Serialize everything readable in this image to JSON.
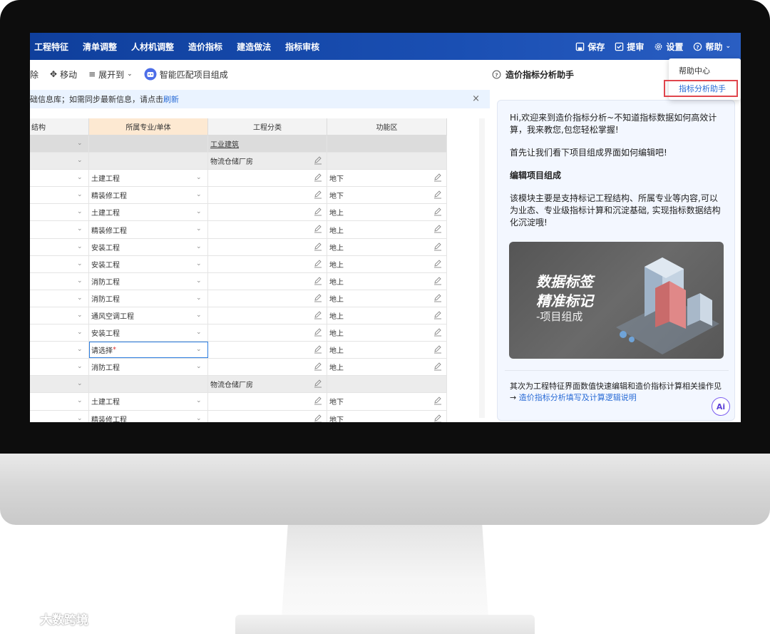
{
  "menu": [
    "工程特征",
    "清单调整",
    "人材机调整",
    "造价指标",
    "建造做法",
    "指标审核"
  ],
  "top_tools": [
    {
      "label": "保存",
      "icon": "save-icon"
    },
    {
      "label": "提审",
      "icon": "submit-icon"
    },
    {
      "label": "设置",
      "icon": "gear-icon"
    },
    {
      "label": "帮助",
      "icon": "help-icon"
    }
  ],
  "toolbar": {
    "delete": "除",
    "move": "移动",
    "expand": "展开到",
    "smart_match": "智能匹配项目组成"
  },
  "notice": {
    "prefix": "础信息库；如需同步最新信息，请点击",
    "link": "刷新",
    "close": "×"
  },
  "table": {
    "headers": [
      "结构",
      "所属专业/单体",
      "工程分类",
      "功能区"
    ],
    "rows": [
      {
        "type": "grp1",
        "c1": "",
        "c2": "",
        "c3": "工业建筑",
        "c4": ""
      },
      {
        "type": "grp",
        "c1": "",
        "c2": "",
        "c3": "物流仓储厂房",
        "c4": ""
      },
      {
        "type": "row",
        "c1": "",
        "c2": "土建工程",
        "c3": "",
        "c4": "地下"
      },
      {
        "type": "row",
        "c1": "",
        "c2": "精装修工程",
        "c3": "",
        "c4": "地下"
      },
      {
        "type": "row",
        "c1": "",
        "c2": "土建工程",
        "c3": "",
        "c4": "地上"
      },
      {
        "type": "row",
        "c1": "",
        "c2": "精装修工程",
        "c3": "",
        "c4": "地上"
      },
      {
        "type": "row",
        "c1": "",
        "c2": "安装工程",
        "c3": "",
        "c4": "地上"
      },
      {
        "type": "row",
        "c1": "",
        "c2": "安装工程",
        "c3": "",
        "c4": "地上"
      },
      {
        "type": "row",
        "c1": "",
        "c2": "消防工程",
        "c3": "",
        "c4": "地上"
      },
      {
        "type": "row",
        "c1": "",
        "c2": "消防工程",
        "c3": "",
        "c4": "地上"
      },
      {
        "type": "row",
        "c1": "",
        "c2": "通风空调工程",
        "c3": "",
        "c4": "地上"
      },
      {
        "type": "row",
        "c1": "",
        "c2": "安装工程",
        "c3": "",
        "c4": "地上"
      },
      {
        "type": "sel",
        "c1": "",
        "c2": "请选择",
        "c3": "",
        "c4": "地上"
      },
      {
        "type": "row",
        "c1": "",
        "c2": "消防工程",
        "c3": "",
        "c4": "地上"
      },
      {
        "type": "grp",
        "c1": "",
        "c2": "",
        "c3": "物流仓储厂房",
        "c4": ""
      },
      {
        "type": "row",
        "c1": "",
        "c2": "土建工程",
        "c3": "",
        "c4": "地下"
      },
      {
        "type": "row",
        "c1": "",
        "c2": "精装修工程",
        "c3": "",
        "c4": "地下"
      }
    ]
  },
  "assistant": {
    "title": "造价指标分析助手",
    "greeting": "Hi,欢迎来到造价指标分析~不知道指标数据如何高效计算，我来教您,包您轻松掌握!",
    "intro": "首先让我们看下项目组成界面如何编辑吧!",
    "section_title": "编辑项目组成",
    "section_body": "该模块主要是支持标记工程结构、所属专业等内容,可以为业态、专业级指标计算和沉淀基础, 实现指标数据结构化沉淀哦!",
    "hero_line1": "数据标签",
    "hero_line2": "精准标记",
    "hero_line3": "-项目组成",
    "footer_text": "其次为工程特征界面数值快速编辑和造价指标计算相关操作见→",
    "footer_link": "造价指标分析填写及计算逻辑说明",
    "ai_label": "Ai"
  },
  "dropdown": {
    "item1": "帮助中心",
    "item2": "指标分析助手"
  },
  "watermark": "大数跨境"
}
